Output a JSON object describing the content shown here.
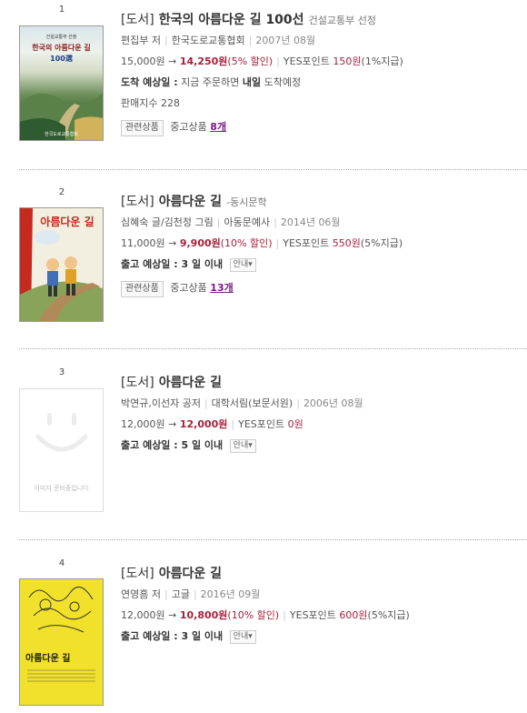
{
  "items": [
    {
      "rank": "1",
      "category": "[도서]",
      "title": "한국의 아름다운 길 100선",
      "subtitle": "건설교통부 선정",
      "author": "편집부 저",
      "publisher": "한국도로교통협회",
      "date": "2007년 08월",
      "price": "15,000원",
      "arrow": "→",
      "sale_price": "14,250원",
      "discount": "(5% 할인)",
      "points_label": "YES포인트",
      "points": "150원",
      "points_rate": "(1%지급)",
      "delivery_label": "도착 예상일 :",
      "delivery_pre": "지금 주문하면",
      "delivery_bold": "내일",
      "delivery_post": "도착예정",
      "sales_index": "판매지수 228",
      "related_label": "관련상품",
      "used_label": "중고상품",
      "used_count": "8개",
      "cover_top": "건설교통부 선정",
      "cover_title": "한국의 아름다운 길",
      "cover_num": "100選",
      "cover_pub": "한국도로교통협회"
    },
    {
      "rank": "2",
      "category": "[도서]",
      "title": "아름다운 길",
      "subtitle": "-동시문학",
      "author": "심혜숙 글/김천정 그림",
      "publisher": "아동문예사",
      "date": "2014년 06월",
      "price": "11,000원",
      "arrow": "→",
      "sale_price": "9,900원",
      "discount": "(10% 할인)",
      "points_label": "YES포인트",
      "points": "550원",
      "points_rate": "(5%지급)",
      "delivery_label": "출고 예상일 : 3 일 이내",
      "guide": "안내▾",
      "related_label": "관련상품",
      "used_label": "중고상품",
      "used_count": "13개",
      "cover_title": "아름다운 길"
    },
    {
      "rank": "3",
      "category": "[도서]",
      "title": "아름다운 길",
      "author": "박연규,이선자 공저",
      "publisher": "대학서림(보문서원)",
      "date": "2006년 08월",
      "price": "12,000원",
      "arrow": "→",
      "sale_price": "12,000원",
      "points_label": "YES포인트",
      "points": "0원",
      "delivery_label": "출고 예상일 : 5 일 이내",
      "guide": "안내▾",
      "cover_placeholder": "이미지 준비중입니다"
    },
    {
      "rank": "4",
      "category": "[도서]",
      "title": "아름다운 길",
      "author": "연영흠 저",
      "publisher": "고글",
      "date": "2016년 09월",
      "price": "12,000원",
      "arrow": "→",
      "sale_price": "10,800원",
      "discount": "(10% 할인)",
      "points_label": "YES포인트",
      "points": "600원",
      "points_rate": "(5%지급)",
      "delivery_label": "출고 예상일 : 3 일 이내",
      "guide": "안내▾",
      "cover_title": "아름다운 길"
    }
  ]
}
